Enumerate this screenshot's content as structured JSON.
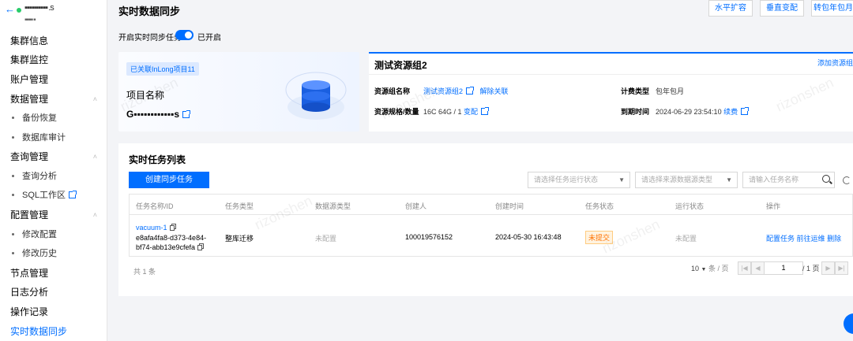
{
  "sidebar": {
    "back_icon": "arrow-left-icon",
    "instance_name": "▪▪▪▪▪▪▪▪▪▪ .s",
    "instance_sub": "▪▪▪▪ ▪",
    "items": [
      {
        "label": "集群信息",
        "type": "item"
      },
      {
        "label": "集群监控",
        "type": "item"
      },
      {
        "label": "账户管理",
        "type": "item"
      },
      {
        "label": "数据管理",
        "type": "group"
      },
      {
        "label": "备份恢复",
        "type": "sub"
      },
      {
        "label": "数据库审计",
        "type": "sub"
      },
      {
        "label": "查询管理",
        "type": "group"
      },
      {
        "label": "查询分析",
        "type": "sub"
      },
      {
        "label": "SQL工作区",
        "type": "sub"
      },
      {
        "label": "配置管理",
        "type": "group"
      },
      {
        "label": "修改配置",
        "type": "sub"
      },
      {
        "label": "修改历史",
        "type": "sub"
      },
      {
        "label": "节点管理",
        "type": "item"
      },
      {
        "label": "日志分析",
        "type": "item"
      },
      {
        "label": "操作记录",
        "type": "item"
      },
      {
        "label": "实时数据同步",
        "type": "item",
        "active": true
      }
    ]
  },
  "header": {
    "title": "实时数据同步",
    "buttons": [
      "水平扩容",
      "垂直变配",
      "转包年包月"
    ]
  },
  "toggle": {
    "label": "开启实时同步任务",
    "state_text": "已开启",
    "on": true
  },
  "project": {
    "badge": "已关联InLong项目11",
    "label": "项目名称",
    "name": "G▪▪▪▪▪▪▪▪▪▪▪▪s"
  },
  "resource_group": {
    "title": "测试资源组2",
    "add_link": "添加资源组",
    "name_label": "资源组名称",
    "name_value": "测试资源组2",
    "unlink": "解除关联",
    "spec_label": "资源规格/数量",
    "spec_value": "16C 64G / 1",
    "spec_action": "变配",
    "billing_label": "计费类型",
    "billing_value": "包年包月",
    "expiry_label": "到期时间",
    "expiry_value": "2024-06-29 23:54:10",
    "renew": "续费"
  },
  "tasks": {
    "title": "实时任务列表",
    "create_button": "创建同步任务",
    "filter_status_placeholder": "请选择任务运行状态",
    "filter_source_placeholder": "请选择来源数据源类型",
    "search_placeholder": "请输入任务名称",
    "columns": [
      "任务名称/ID",
      "任务类型",
      "数据源类型",
      "创建人",
      "创建时间",
      "任务状态",
      "运行状态",
      "操作"
    ],
    "rows": [
      {
        "name": "vacuum-1",
        "id_line1": "e8afa4fa8-d373-4e84-",
        "id_line2": "bf74-abb13e9cfefa",
        "type": "整库迁移",
        "source": "未配置",
        "creator": "100019576152",
        "created_at": "2024-05-30 16:43:48",
        "status": "未提交",
        "run_status": "未配置",
        "actions": [
          "配置任务",
          "前往运维",
          "删除"
        ]
      }
    ],
    "total": "共 1 条",
    "page_size": "10",
    "page_size_unit": "条 / 页",
    "current_page": "1",
    "total_pages": "/ 1 页"
  },
  "watermark": "rizonshen",
  "colors": {
    "accent": "#006eff",
    "status_warn": "#ff7200"
  }
}
